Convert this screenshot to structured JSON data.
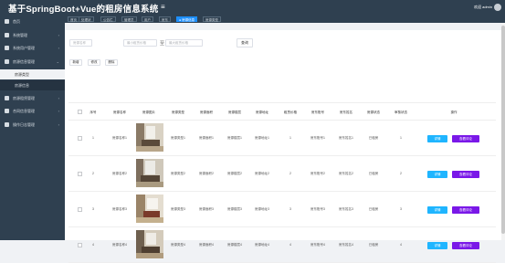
{
  "header": {
    "title": "基于SpringBoot+Vue的租房信息系统",
    "menu_toggle": "≡",
    "user": "欢迎 admin"
  },
  "tabs": [
    {
      "label": "首页",
      "active": false
    },
    {
      "label": "处理状",
      "active": false
    },
    {
      "label": "公告栏",
      "active": false
    },
    {
      "label": "管理员",
      "active": false
    },
    {
      "label": "用户",
      "active": false
    },
    {
      "label": "房东",
      "active": false
    },
    {
      "label": "● 房源信息",
      "active": true
    },
    {
      "label": "房源类型",
      "active": false
    }
  ],
  "sidebar": {
    "items": [
      {
        "label": "首页",
        "arrow": ""
      },
      {
        "label": "系统管理",
        "arrow": "›"
      },
      {
        "label": "系统用户管理",
        "arrow": "›"
      },
      {
        "label": "房源信息管理",
        "arrow": "⌄"
      }
    ],
    "subitems": [
      {
        "label": "房源类型",
        "active": true
      },
      {
        "label": "房源信息",
        "active": false
      }
    ],
    "items2": [
      {
        "label": "房源租赁管理",
        "arrow": "›"
      },
      {
        "label": "合同信息管理",
        "arrow": "›"
      },
      {
        "label": "操作日志管理",
        "arrow": "›"
      }
    ]
  },
  "search": {
    "name_placeholder": "房源名称",
    "min_rent_placeholder": "最小租赁价格",
    "tilde": "至",
    "max_rent_placeholder": "最大租赁价格",
    "query_label": "查询"
  },
  "actions": {
    "add_label": "新增",
    "edit_label": "修改",
    "delete_label": "删除"
  },
  "table": {
    "headers": [
      "序号",
      "房源名称",
      "房源图片",
      "房源类型",
      "房源面积",
      "房源楼层",
      "房源地址",
      "租赁价格",
      "房东账号",
      "房东姓名",
      "房源状态",
      "审核状态",
      "操作"
    ],
    "rows": [
      {
        "no": "1",
        "name": "房源名称1",
        "type": "房源类型1",
        "area": "房源面积1",
        "floor": "房源楼层1",
        "address": "房源地址1",
        "price": "1",
        "landlord_account": "房东账号1",
        "landlord_name": "房东姓名1",
        "status": "已租房",
        "review": "1"
      },
      {
        "no": "2",
        "name": "房源名称2",
        "type": "房源类型2",
        "area": "房源面积2",
        "floor": "房源楼层2",
        "address": "房源地址2",
        "price": "2",
        "landlord_account": "房东账号2",
        "landlord_name": "房东姓名2",
        "status": "已租房",
        "review": "2"
      },
      {
        "no": "3",
        "name": "房源名称3",
        "type": "房源类型3",
        "area": "房源面积3",
        "floor": "房源楼层3",
        "address": "房源地址3",
        "price": "3",
        "landlord_account": "房东账号3",
        "landlord_name": "房东姓名3",
        "status": "已租房",
        "review": "3"
      },
      {
        "no": "4",
        "name": "房源名称4",
        "type": "房源类型4",
        "area": "房源面积4",
        "floor": "房源楼层4",
        "address": "房源地址4",
        "price": "4",
        "landlord_account": "房东账号4",
        "landlord_name": "房东姓名4",
        "status": "已租房",
        "review": "4"
      }
    ],
    "detail_label": "详情",
    "review_label": "查看评论"
  },
  "colors": {
    "sidebar_bg": "#2f4050",
    "active_tab": "#1e90ff",
    "detail_button": "#1fb5ff",
    "review_button": "#7a18e8"
  }
}
